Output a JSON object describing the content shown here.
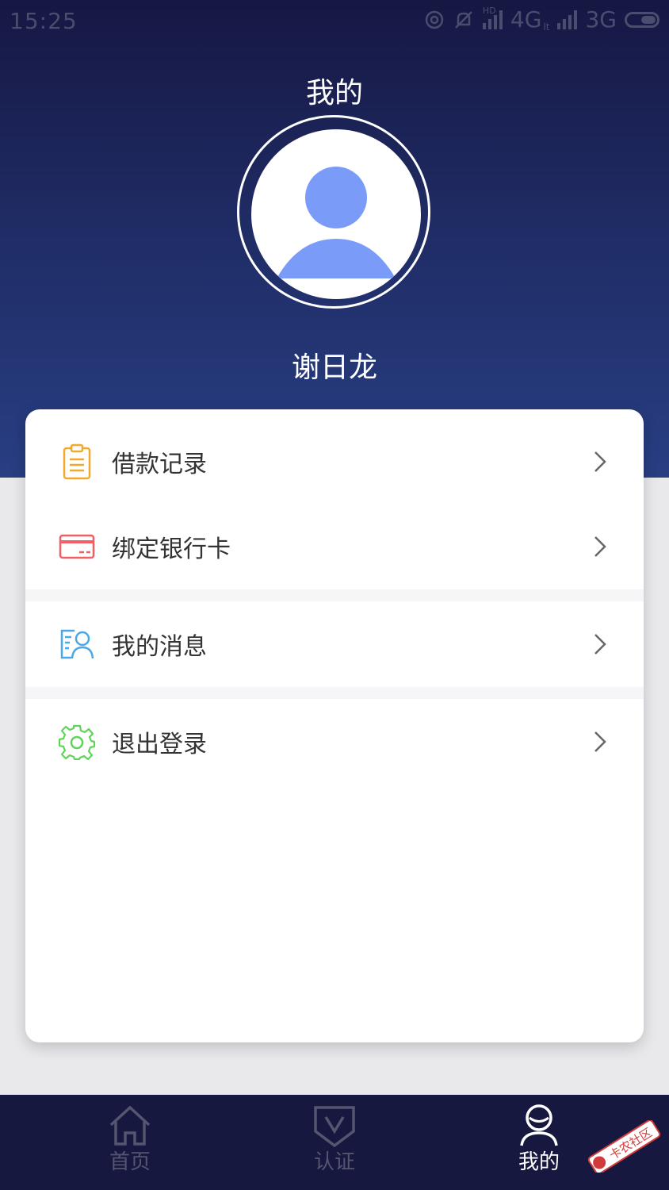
{
  "status_bar": {
    "time": "15:25",
    "network_1": "4G",
    "network_2": "3G",
    "hd_label": "HD",
    "lte_label": "lt"
  },
  "header": {
    "title": "我的",
    "user_name": "谢日龙"
  },
  "menu": [
    {
      "label": "借款记录",
      "icon": "clipboard-icon",
      "color": "#f0a92c"
    },
    {
      "label": "绑定银行卡",
      "icon": "bank-card-icon",
      "color": "#ef5f63"
    },
    {
      "label": "我的消息",
      "icon": "message-contacts-icon",
      "color": "#49a8e8"
    },
    {
      "label": "退出登录",
      "icon": "gear-icon",
      "color": "#5fd35a"
    }
  ],
  "tabbar": {
    "tabs": [
      {
        "label": "首页",
        "icon": "home-icon",
        "active": false
      },
      {
        "label": "认证",
        "icon": "verify-shield-icon",
        "active": false
      },
      {
        "label": "我的",
        "icon": "person-icon",
        "active": true
      }
    ]
  },
  "watermark": {
    "text": "卡农社区"
  },
  "colors": {
    "header_top": "#161743",
    "header_bottom": "#283e83",
    "avatar_fill": "#7a9cf8",
    "tabbar_bg": "#171840",
    "tab_active": "#ffffff",
    "tab_inactive": "#54566f"
  }
}
